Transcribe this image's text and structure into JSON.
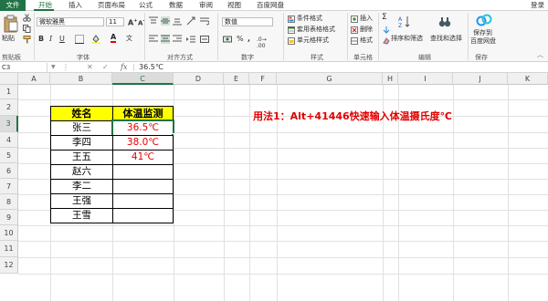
{
  "menubar": {
    "file": "文件",
    "tabs": [
      "开始",
      "插入",
      "页面布局",
      "公式",
      "数据",
      "审阅",
      "视图",
      "百度网盘"
    ],
    "login": "登录"
  },
  "ribbon": {
    "paste": "粘贴",
    "font_name": "微软雅黑",
    "font_size": "11",
    "bold": "B",
    "italic": "I",
    "underline": "U",
    "font_color_glyph": "A",
    "wen": "文",
    "number_format": "数值",
    "percent": "%",
    "comma": ",",
    "cond_format": "条件格式",
    "table_format": "套用表格格式",
    "cell_style": "单元格样式",
    "insert": "插入",
    "delete": "删除",
    "format": "格式",
    "sort_filter": "排序和筛选",
    "find_select": "查找和选择",
    "save_to": "保存到",
    "baidu_disk": "百度网盘",
    "groups": {
      "clipboard": "剪贴板",
      "font": "字体",
      "alignment": "对齐方式",
      "number": "数字",
      "styles": "样式",
      "cells": "单元格",
      "editing": "编辑",
      "save": "保存"
    }
  },
  "formula_bar": {
    "name_box": "C3",
    "fx": "fx",
    "value": "36.5℃"
  },
  "sheet": {
    "columns": [
      "A",
      "B",
      "C",
      "D",
      "E",
      "F",
      "G",
      "H",
      "I",
      "J",
      "K"
    ],
    "rows": [
      "1",
      "2",
      "3",
      "4",
      "5",
      "6",
      "7",
      "8",
      "9",
      "10",
      "11",
      "12"
    ],
    "selected_cell": "C3",
    "table_header": {
      "name": "姓名",
      "temp": "体温监测"
    },
    "table_rows": [
      {
        "name": "张三",
        "temp": "36.5℃"
      },
      {
        "name": "李四",
        "temp": "38.0℃"
      },
      {
        "name": "王五",
        "temp": "41℃"
      },
      {
        "name": "赵六",
        "temp": ""
      },
      {
        "name": "李二",
        "temp": ""
      },
      {
        "name": "王强",
        "temp": ""
      },
      {
        "name": "王雪",
        "temp": ""
      }
    ],
    "annotation": "用法1：Alt+41446快速输入体温摄氏度℃"
  },
  "colors": {
    "accent": "#217346",
    "header_fill": "#ffff00",
    "temp_text": "#e60000",
    "annotation_text": "#e60000"
  }
}
